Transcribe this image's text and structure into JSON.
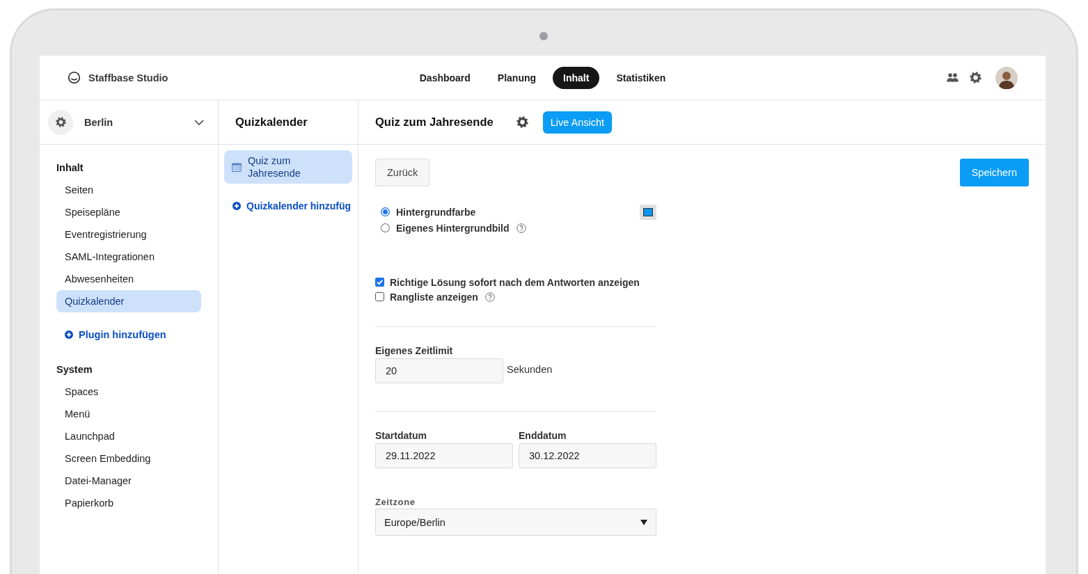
{
  "app": {
    "name": "Staffbase Studio"
  },
  "nav": [
    {
      "label": "Dashboard",
      "selected": false
    },
    {
      "label": "Planung",
      "selected": false
    },
    {
      "label": "Inhalt",
      "selected": true
    },
    {
      "label": "Statistiken",
      "selected": false
    }
  ],
  "sidebar": {
    "space": "Berlin",
    "sections": [
      {
        "title": "Inhalt",
        "items": [
          {
            "label": "Seiten",
            "selected": false
          },
          {
            "label": "Speisepläne",
            "selected": false
          },
          {
            "label": "Eventregistrierung",
            "selected": false
          },
          {
            "label": "SAML-Integrationen",
            "selected": false
          },
          {
            "label": "Abwesenheiten",
            "selected": false
          },
          {
            "label": "Quizkalender",
            "selected": true
          }
        ],
        "add_link": "Plugin hinzufügen"
      },
      {
        "title": "System",
        "items": [
          {
            "label": "Spaces",
            "selected": false
          },
          {
            "label": "Menü",
            "selected": false
          },
          {
            "label": "Launchpad",
            "selected": false
          },
          {
            "label": "Screen Embedding",
            "selected": false
          },
          {
            "label": "Datei-Manager",
            "selected": false
          },
          {
            "label": "Papierkorb",
            "selected": false
          }
        ]
      }
    ]
  },
  "quiz_list": {
    "title": "Quizkalender",
    "items": [
      {
        "label": "Quiz zum Jahresende",
        "selected": true
      }
    ],
    "add_link": "Quizkalender hinzufüg"
  },
  "editor": {
    "title": "Quiz zum Jahresende",
    "live_button": "Live Ansicht",
    "back_button": "Zurück",
    "save_button": "Speichern",
    "background_options": [
      {
        "kind": "color",
        "label": "Hintergrundfarbe",
        "selected": true,
        "help": false
      },
      {
        "kind": "image",
        "label": "Eigenes Hintergrundbild",
        "selected": false,
        "help": true
      }
    ],
    "display_options": [
      {
        "label": "Richtige Lösung sofort nach dem Antworten anzeigen",
        "checked": true,
        "help": false
      },
      {
        "label": "Rangliste anzeigen",
        "checked": false,
        "help": true
      }
    ],
    "time_limit": {
      "label": "Eigenes Zeitlimit",
      "value": "20",
      "unit": "Sekunden"
    },
    "dates": [
      {
        "label": "Startdatum",
        "value": "29.11.2022"
      },
      {
        "label": "Enddatum",
        "value": "30.12.2022"
      }
    ],
    "timezone": {
      "label": "Zeitzone",
      "value": "Europe/Berlin"
    }
  }
}
